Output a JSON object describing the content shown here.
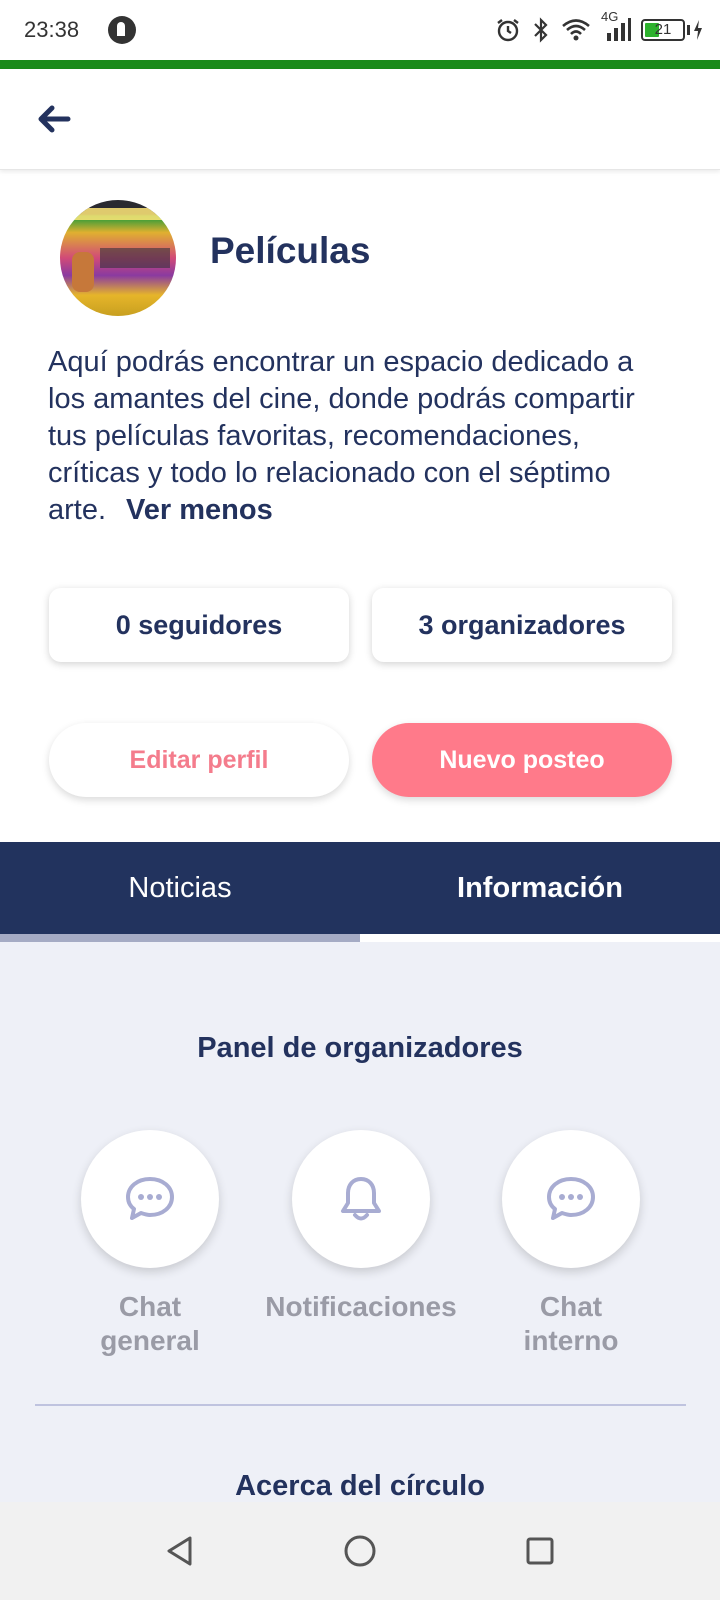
{
  "status_bar": {
    "time": "23:38",
    "network": "4G",
    "battery": "21"
  },
  "icons": {
    "back": "arrow-left-icon",
    "app": "app-notification-icon",
    "alarm": "alarm-icon",
    "bluetooth": "bluetooth-icon",
    "wifi": "wifi-icon",
    "signal": "signal-icon",
    "battery": "battery-icon",
    "chat": "chat-bubble-icon",
    "bell": "bell-icon"
  },
  "profile": {
    "title": "Películas",
    "description": "Aquí podrás encontrar un espacio dedicado a los amantes del cine, donde podrás compartir tus películas favoritas, recomendaciones, críticas y todo lo relacionado con el séptimo arte.",
    "see_less": "Ver menos"
  },
  "stats": {
    "followers": "0 seguidores",
    "organizers": "3 organizadores"
  },
  "buttons": {
    "edit_profile": "Editar perfil",
    "new_post": "Nuevo posteo"
  },
  "tabs": {
    "news": "Noticias",
    "info": "Información"
  },
  "panel": {
    "title": "Panel de organizadores",
    "actions": [
      {
        "label_line1": "Chat",
        "label_line2": "general"
      },
      {
        "label_line1": "Notificaciones",
        "label_line2": ""
      },
      {
        "label_line1": "Chat",
        "label_line2": "interno"
      }
    ]
  },
  "about_title": "Acerca del círculo",
  "colors": {
    "accent_green": "#1a8a1a",
    "navy": "#22335e",
    "pink": "#ff7a8a",
    "panel_bg": "#eef0f7",
    "icon_tint": "#a8acd2"
  }
}
